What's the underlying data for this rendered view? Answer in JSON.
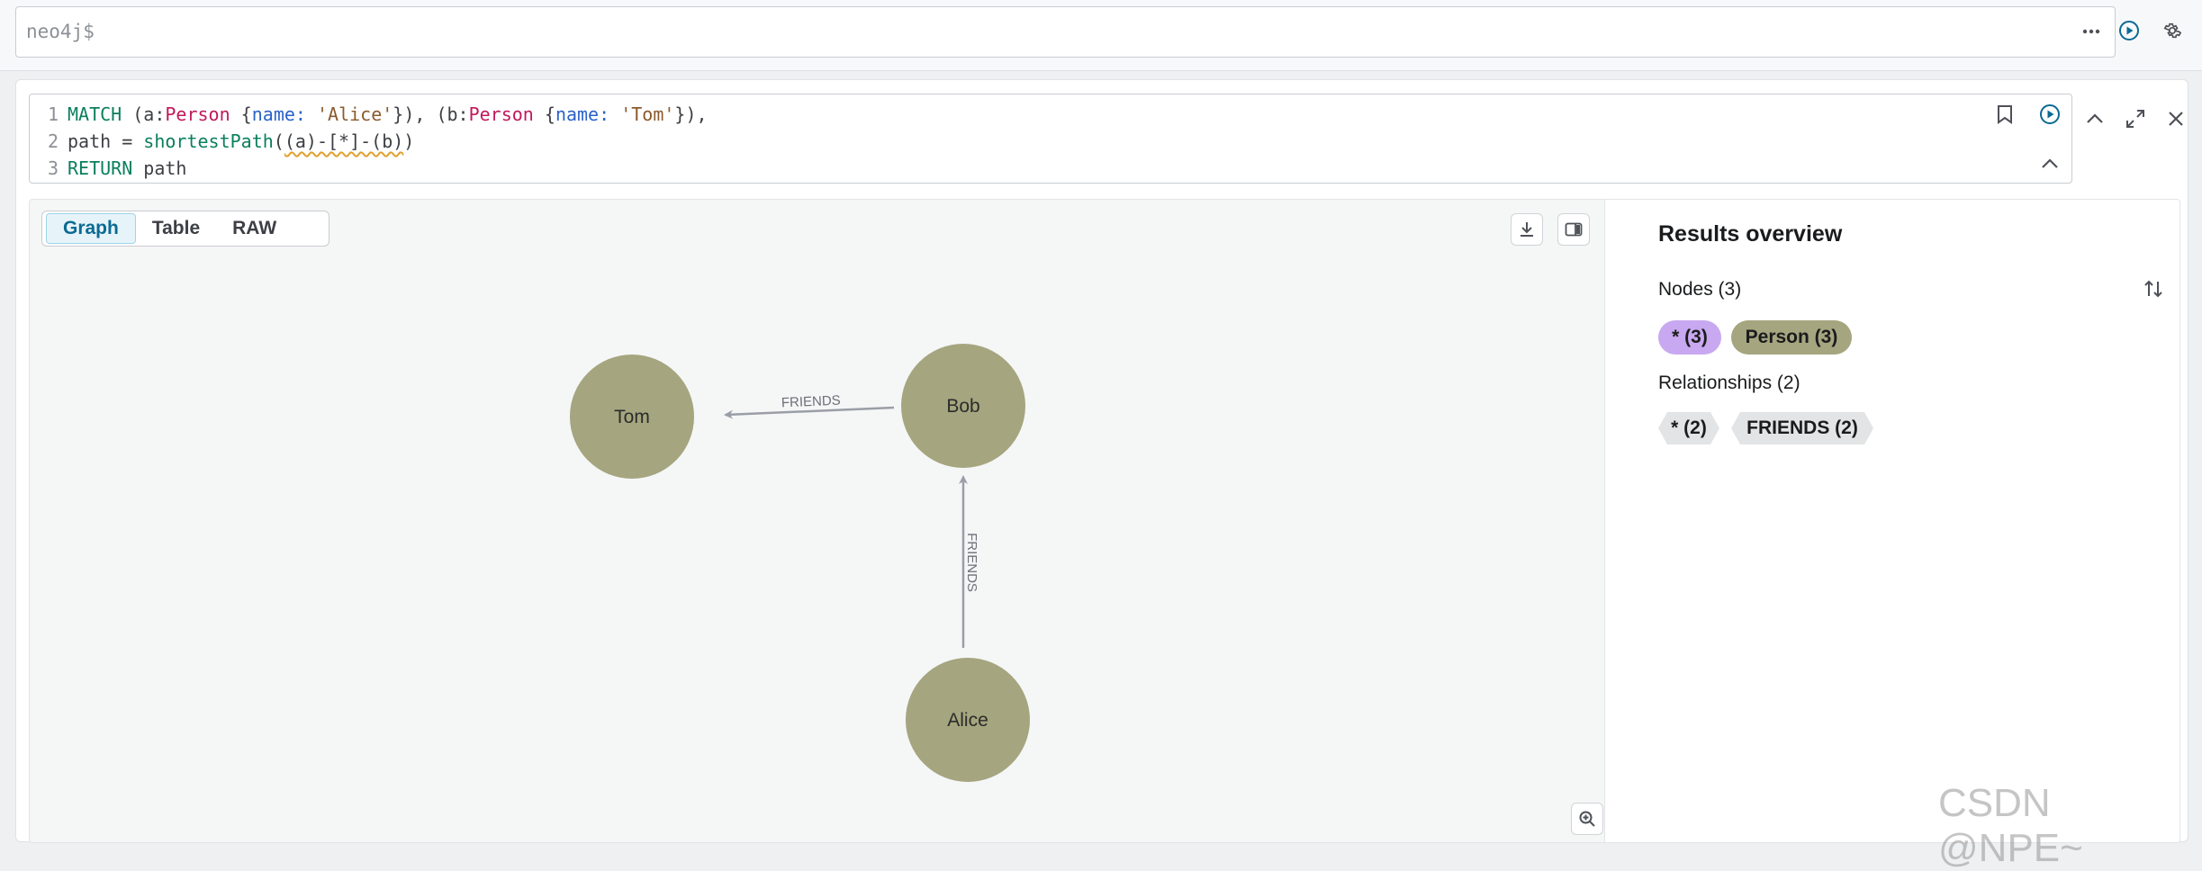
{
  "topbar": {
    "prompt": "neo4j$"
  },
  "editor": {
    "lines": [
      {
        "num": "1",
        "parts": [
          {
            "cls": "k",
            "text": "MATCH"
          },
          {
            "cls": "t",
            "text": " (a:"
          },
          {
            "cls": "l",
            "text": "Person"
          },
          {
            "cls": "t",
            "text": " {"
          },
          {
            "cls": "p",
            "text": "name:"
          },
          {
            "cls": "t",
            "text": " "
          },
          {
            "cls": "s",
            "text": "'Alice'"
          },
          {
            "cls": "t",
            "text": "}), (b:"
          },
          {
            "cls": "l",
            "text": "Person"
          },
          {
            "cls": "t",
            "text": " {"
          },
          {
            "cls": "p",
            "text": "name:"
          },
          {
            "cls": "t",
            "text": " "
          },
          {
            "cls": "s",
            "text": "'Tom'"
          },
          {
            "cls": "t",
            "text": "}),"
          }
        ]
      },
      {
        "num": "2",
        "parts": [
          {
            "cls": "t",
            "text": "path = "
          },
          {
            "cls": "k",
            "text": "shortestPath"
          },
          {
            "cls": "t",
            "text": "("
          },
          {
            "cls": "t squig",
            "text": "(a)-[*]-(b)"
          },
          {
            "cls": "t",
            "text": ")"
          }
        ]
      },
      {
        "num": "3",
        "parts": [
          {
            "cls": "k",
            "text": "RETURN"
          },
          {
            "cls": "t",
            "text": " path"
          }
        ]
      }
    ]
  },
  "tabs": [
    {
      "label": "Graph",
      "active": true
    },
    {
      "label": "Table",
      "active": false
    },
    {
      "label": "RAW",
      "active": false
    }
  ],
  "graph": {
    "nodes": [
      {
        "id": "tom",
        "label": "Tom",
        "color": "#a5a57f"
      },
      {
        "id": "bob",
        "label": "Bob",
        "color": "#a5a57f"
      },
      {
        "id": "alice",
        "label": "Alice",
        "color": "#a5a57f"
      }
    ],
    "relationships": [
      {
        "from": "bob",
        "to": "tom",
        "type": "FRIENDS"
      },
      {
        "from": "alice",
        "to": "bob",
        "type": "FRIENDS"
      }
    ]
  },
  "overview": {
    "title": "Results overview",
    "nodes_label": "Nodes (3)",
    "node_pills": [
      {
        "label": "* (3)",
        "color": "#c8a8f0"
      },
      {
        "label": "Person (3)",
        "color": "#a5a57f"
      }
    ],
    "relationships_label": "Relationships (2)",
    "rel_pills": [
      {
        "label": "* (2)"
      },
      {
        "label": "FRIENDS (2)"
      }
    ]
  },
  "watermark": "CSDN @NPE~"
}
